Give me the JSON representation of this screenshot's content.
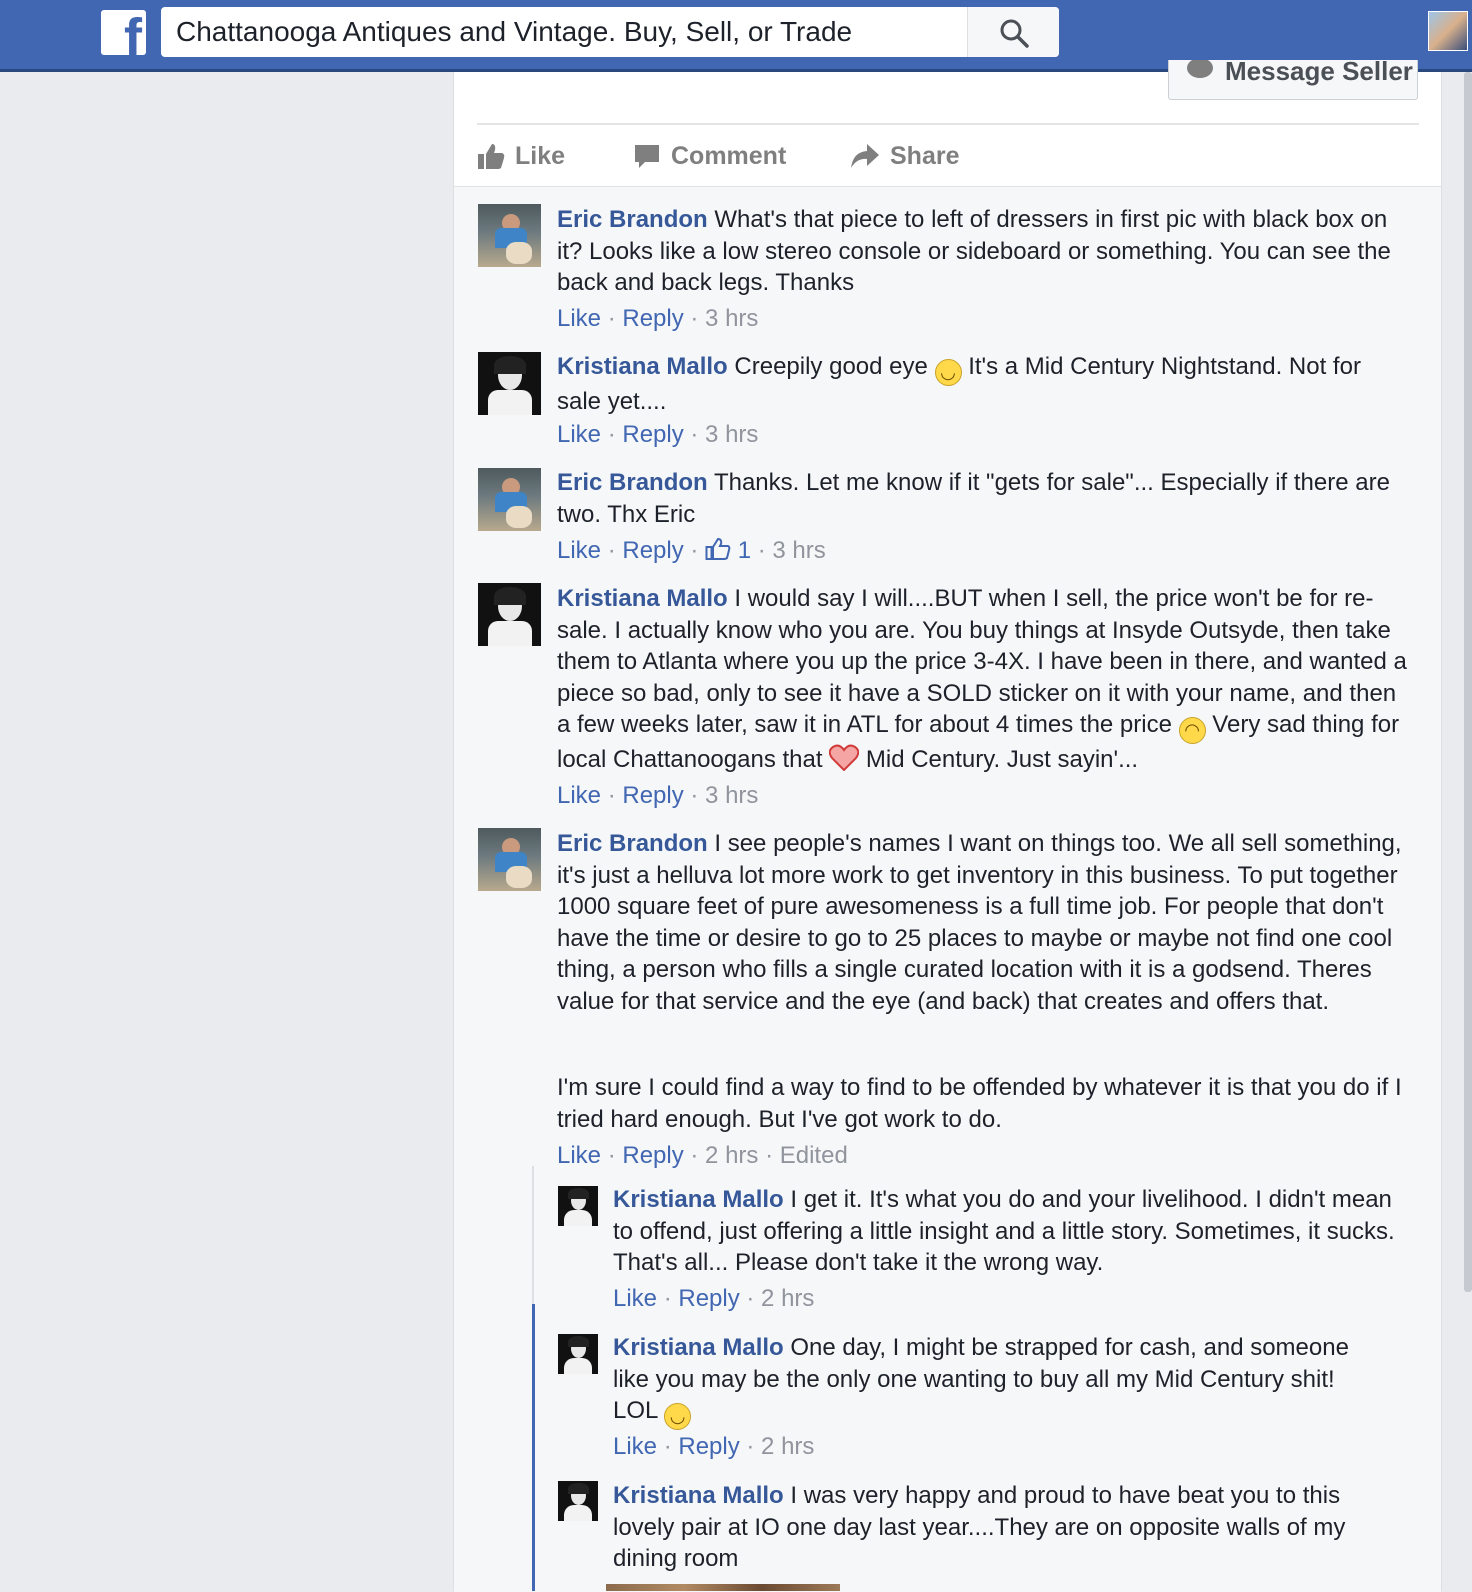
{
  "topbar": {
    "logo": "f",
    "search_value": "Chattanooga Antiques and Vintage. Buy, Sell, or Trade",
    "search_icon": "magnifier",
    "brand_color": "#4267b2"
  },
  "post": {
    "message_seller": "Message Seller",
    "actions": {
      "like": "Like",
      "comment": "Comment",
      "share": "Share"
    }
  },
  "comments": [
    {
      "author": "Eric Brandon",
      "text": "What's that piece to left of dressers in first pic with black box on it? Looks like a low stereo console or sideboard or something. You can see the back and back legs. Thanks",
      "like": "Like",
      "reply": "Reply",
      "time": "3 hrs"
    },
    {
      "author": "Kristiana Mallo",
      "text_before": "Creepily good eye",
      "text_after": "It's a Mid Century Nightstand. Not for sale yet....",
      "like": "Like",
      "reply": "Reply",
      "time": "3 hrs"
    },
    {
      "author": "Eric Brandon",
      "text": "Thanks. Let me know if it \"gets for sale\"... Especially if there are two. Thx Eric",
      "like": "Like",
      "reply": "Reply",
      "like_count": "1",
      "time": "3 hrs"
    },
    {
      "author": "Kristiana Mallo",
      "text_1": "I would say I will....BUT when I sell, the price won't be for re-sale. I actually know who you are. You buy things at Insyde Outsyde, then take them to Atlanta where you up the price 3-4X. I have been in there, and wanted a piece so bad, only to see it have a SOLD sticker on it with your name, and then a few weeks later, saw it in ATL for about 4 times the price",
      "text_2": "Very sad thing for local Chattanoogans that",
      "text_3": "Mid Century. Just sayin'...",
      "like": "Like",
      "reply": "Reply",
      "time": "3 hrs"
    },
    {
      "author": "Eric Brandon",
      "text": "I see people's names I want on things too. We all sell something, it's just a helluva lot more work to get inventory in this business. To put together 1000 square feet of pure awesomeness is a full time job. For people that don't have the time or desire to go to 25 places to maybe or maybe not find one cool thing, a person who fills a single curated location with it is a godsend. Theres value for that service and the eye (and back) that creates and offers that.",
      "text_2": "I'm sure I could find a way to find to be offended by whatever it is that you do if I tried hard enough. But I've got work to do.",
      "like": "Like",
      "reply": "Reply",
      "time": "2 hrs",
      "edited": "Edited"
    }
  ],
  "replies": [
    {
      "author": "Kristiana Mallo",
      "text": "I get it. It's what you do and your livelihood. I didn't mean to offend, just offering a little insight and a little story. Sometimes, it sucks. That's all... Please don't take it the wrong way.",
      "like": "Like",
      "reply": "Reply",
      "time": "2 hrs"
    },
    {
      "author": "Kristiana Mallo",
      "text": "One day, I might be strapped for cash, and someone like you may be the only one wanting to buy all my Mid Century shit! LOL",
      "like": "Like",
      "reply": "Reply",
      "time": "2 hrs"
    },
    {
      "author": "Kristiana Mallo",
      "text": "I was very happy and proud to have beat you to this lovely pair at IO one day last year....They are on opposite walls of my dining room"
    }
  ],
  "colors": {
    "link": "#365899",
    "meta": "#90949c",
    "background": "#e9ebee"
  }
}
